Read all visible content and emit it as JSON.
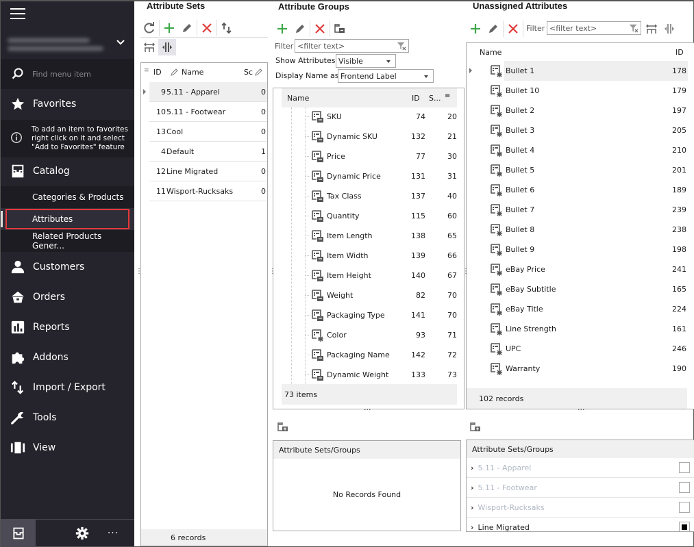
{
  "sidebar": {
    "search_placeholder": "Find menu item",
    "favorites_label": "Favorites",
    "favorites_tip": [
      "To add an item to favorites",
      "right click on it and select",
      "\"Add to Favorites\" feature"
    ],
    "catalog_label": "Catalog",
    "catalog_sub": [
      "Categories & Products",
      "Attributes",
      "Related Products Gener..."
    ],
    "active_sub": "Attributes",
    "items": [
      {
        "label": "Customers",
        "icon": "user-icon"
      },
      {
        "label": "Orders",
        "icon": "basket-icon"
      },
      {
        "label": "Reports",
        "icon": "bar-chart-icon"
      },
      {
        "label": "Addons",
        "icon": "puzzle-icon"
      },
      {
        "label": "Import / Export",
        "icon": "arrows-up-down-icon"
      },
      {
        "label": "Tools",
        "icon": "wrench-icon"
      },
      {
        "label": "View",
        "icon": "columns-icon"
      }
    ],
    "bottom_more": "···"
  },
  "attribute_sets": {
    "title": "Attribute Sets",
    "columns": {
      "id": "ID",
      "name": "Name",
      "sort": "Sc"
    },
    "rows": [
      {
        "id": "9",
        "name": "5.11 - Apparel",
        "sort": "0"
      },
      {
        "id": "10",
        "name": "5.11 - Footwear",
        "sort": "0"
      },
      {
        "id": "13",
        "name": "Cool",
        "sort": "0"
      },
      {
        "id": "4",
        "name": "Default",
        "sort": "1"
      },
      {
        "id": "12",
        "name": "Line Migrated",
        "sort": "0"
      },
      {
        "id": "11",
        "name": "Wisport-Rucksaks",
        "sort": "0"
      }
    ],
    "footer": "6 records"
  },
  "attribute_groups": {
    "title": "Attribute Groups",
    "filter_label": "Filter",
    "filter_placeholder": "<filter text>",
    "show_attributes_label": "Show Attributes",
    "show_attributes_value": "Visible",
    "display_name_label": "Display Name as",
    "display_name_value": "Frontend Label",
    "columns": {
      "name": "Name",
      "id": "ID",
      "sort": "S..."
    },
    "rows": [
      {
        "name": "SKU",
        "id": "74",
        "sort": "20",
        "icon": "attribute-icon"
      },
      {
        "name": "Dynamic SKU",
        "id": "132",
        "sort": "21",
        "icon": "attribute-icon"
      },
      {
        "name": "Price",
        "id": "77",
        "sort": "30",
        "icon": "attribute-icon"
      },
      {
        "name": "Dynamic Price",
        "id": "131",
        "sort": "31",
        "icon": "attribute-icon"
      },
      {
        "name": "Tax Class",
        "id": "137",
        "sort": "40",
        "icon": "attribute-icon"
      },
      {
        "name": "Quantity",
        "id": "115",
        "sort": "60",
        "icon": "attribute-icon"
      },
      {
        "name": "Item Length",
        "id": "138",
        "sort": "65",
        "icon": "attribute-icon"
      },
      {
        "name": "Item Width",
        "id": "139",
        "sort": "66",
        "icon": "attribute-icon"
      },
      {
        "name": "Item Height",
        "id": "140",
        "sort": "67",
        "icon": "attribute-icon"
      },
      {
        "name": "Weight",
        "id": "82",
        "sort": "70",
        "icon": "attribute-icon"
      },
      {
        "name": "Packaging Type",
        "id": "141",
        "sort": "70",
        "icon": "attribute-icon"
      },
      {
        "name": "Color",
        "id": "93",
        "sort": "71",
        "icon": "custom-attribute-icon"
      },
      {
        "name": "Packaging Name",
        "id": "142",
        "sort": "72",
        "icon": "attribute-icon"
      },
      {
        "name": "Dynamic Weight",
        "id": "133",
        "sort": "73",
        "icon": "attribute-icon"
      }
    ],
    "footer": "73 items",
    "sets_header": "Attribute Sets/Groups",
    "sets_empty": "No Records Found"
  },
  "unassigned_attributes": {
    "title": "Unassigned Attributes",
    "filter_label": "Filter",
    "filter_placeholder": "<filter text>",
    "columns": {
      "name": "Name",
      "id": "ID"
    },
    "rows": [
      {
        "name": "Bullet 1",
        "id": "178"
      },
      {
        "name": "Bullet 10",
        "id": "179"
      },
      {
        "name": "Bullet 2",
        "id": "197"
      },
      {
        "name": "Bullet 3",
        "id": "205"
      },
      {
        "name": "Bullet 4",
        "id": "210"
      },
      {
        "name": "Bullet 5",
        "id": "201"
      },
      {
        "name": "Bullet 6",
        "id": "189"
      },
      {
        "name": "Bullet 7",
        "id": "239"
      },
      {
        "name": "Bullet 8",
        "id": "238"
      },
      {
        "name": "Bullet 9",
        "id": "198"
      },
      {
        "name": "eBay Price",
        "id": "241"
      },
      {
        "name": "eBay Subtitle",
        "id": "165"
      },
      {
        "name": "eBay Title",
        "id": "224"
      },
      {
        "name": "Line Strength",
        "id": "161"
      },
      {
        "name": "UPC",
        "id": "246"
      },
      {
        "name": "Warranty",
        "id": "190"
      }
    ],
    "footer": "102 records",
    "sets_header": "Attribute Sets/Groups",
    "sets_rows": [
      {
        "name": "5.11 - Apparel",
        "checked": false,
        "enabled": false
      },
      {
        "name": "5.11 - Footwear",
        "checked": false,
        "enabled": false
      },
      {
        "name": "Wisport-Rucksaks",
        "checked": false,
        "enabled": false
      },
      {
        "name": "Line Migrated",
        "checked": true,
        "enabled": true
      }
    ]
  },
  "colors": {
    "add": "#3ea84a",
    "delete": "#e03a3a",
    "highlight": "#e5393b",
    "sidebar_bg": "#25242c"
  }
}
